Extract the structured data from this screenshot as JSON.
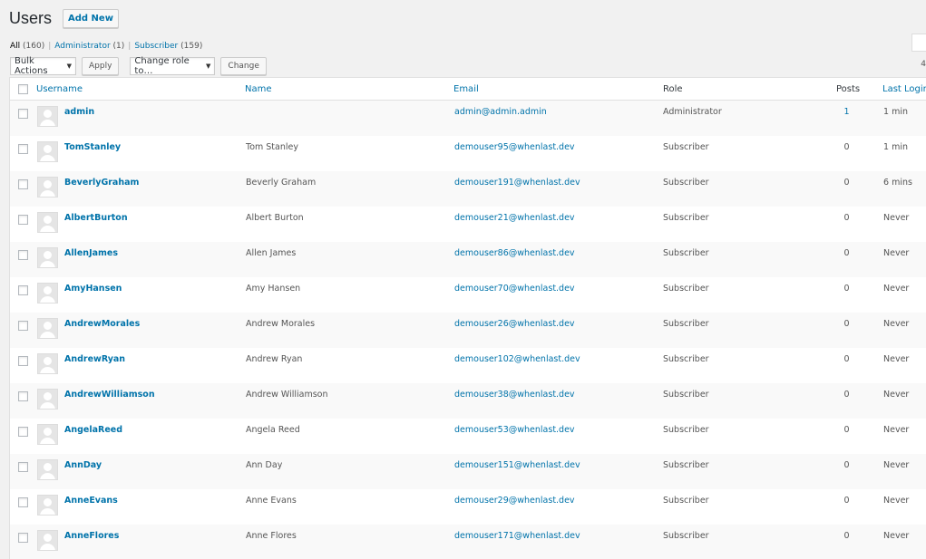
{
  "header": {
    "title": "Users",
    "add_new": "Add New"
  },
  "views": [
    {
      "label": "All",
      "count": "(160)",
      "current": true
    },
    {
      "label": "Administrator",
      "count": "(1)",
      "current": false
    },
    {
      "label": "Subscriber",
      "count": "(159)",
      "current": false
    }
  ],
  "toolbar": {
    "bulk_actions": "Bulk Actions",
    "apply": "Apply",
    "change_role": "Change role to…",
    "change": "Change",
    "items_count_partial": "4"
  },
  "columns": {
    "username": "Username",
    "name": "Name",
    "email": "Email",
    "role": "Role",
    "posts": "Posts",
    "last_login": "Last Login"
  },
  "users": [
    {
      "username": "admin",
      "name": "",
      "email": "admin@admin.admin",
      "role": "Administrator",
      "posts": "1",
      "last_login": "1 min"
    },
    {
      "username": "TomStanley",
      "name": "Tom Stanley",
      "email": "demouser95@whenlast.dev",
      "role": "Subscriber",
      "posts": "0",
      "last_login": "1 min"
    },
    {
      "username": "BeverlyGraham",
      "name": "Beverly Graham",
      "email": "demouser191@whenlast.dev",
      "role": "Subscriber",
      "posts": "0",
      "last_login": "6 mins"
    },
    {
      "username": "AlbertBurton",
      "name": "Albert Burton",
      "email": "demouser21@whenlast.dev",
      "role": "Subscriber",
      "posts": "0",
      "last_login": "Never"
    },
    {
      "username": "AllenJames",
      "name": "Allen James",
      "email": "demouser86@whenlast.dev",
      "role": "Subscriber",
      "posts": "0",
      "last_login": "Never"
    },
    {
      "username": "AmyHansen",
      "name": "Amy Hansen",
      "email": "demouser70@whenlast.dev",
      "role": "Subscriber",
      "posts": "0",
      "last_login": "Never"
    },
    {
      "username": "AndrewMorales",
      "name": "Andrew Morales",
      "email": "demouser26@whenlast.dev",
      "role": "Subscriber",
      "posts": "0",
      "last_login": "Never"
    },
    {
      "username": "AndrewRyan",
      "name": "Andrew Ryan",
      "email": "demouser102@whenlast.dev",
      "role": "Subscriber",
      "posts": "0",
      "last_login": "Never"
    },
    {
      "username": "AndrewWilliamson",
      "name": "Andrew Williamson",
      "email": "demouser38@whenlast.dev",
      "role": "Subscriber",
      "posts": "0",
      "last_login": "Never"
    },
    {
      "username": "AngelaReed",
      "name": "Angela Reed",
      "email": "demouser53@whenlast.dev",
      "role": "Subscriber",
      "posts": "0",
      "last_login": "Never"
    },
    {
      "username": "AnnDay",
      "name": "Ann Day",
      "email": "demouser151@whenlast.dev",
      "role": "Subscriber",
      "posts": "0",
      "last_login": "Never"
    },
    {
      "username": "AnneEvans",
      "name": "Anne Evans",
      "email": "demouser29@whenlast.dev",
      "role": "Subscriber",
      "posts": "0",
      "last_login": "Never"
    },
    {
      "username": "AnneFlores",
      "name": "Anne Flores",
      "email": "demouser171@whenlast.dev",
      "role": "Subscriber",
      "posts": "0",
      "last_login": "Never"
    }
  ]
}
